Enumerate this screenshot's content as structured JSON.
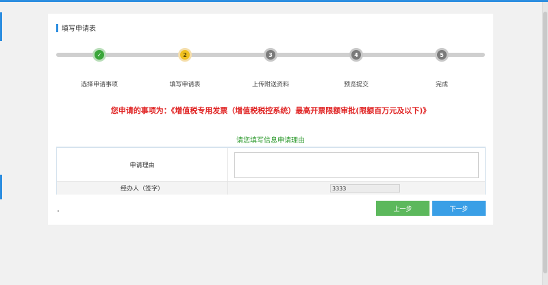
{
  "panel": {
    "title": "填写申请表"
  },
  "steps": [
    {
      "num": "✓",
      "label": "选择申请事项",
      "state": "done"
    },
    {
      "num": "2",
      "label": "填写申请表",
      "state": "current"
    },
    {
      "num": "3",
      "label": "上传附送资料",
      "state": "pending"
    },
    {
      "num": "4",
      "label": "预览提交",
      "state": "pending"
    },
    {
      "num": "5",
      "label": "完成",
      "state": "pending"
    }
  ],
  "notice": "您申请的事项为：《增值税专用发票（增值税税控系统）最高开票限额审批(限额百万元及以下)》",
  "form": {
    "heading": "请您填写信息申请理由",
    "reason_label": "申请理由",
    "reason_value": "",
    "agent_label": "经办人（签字）",
    "agent_value": "3333"
  },
  "buttons": {
    "prev": "上一步",
    "next": "下一步"
  },
  "colors": {
    "accent": "#2d8ee0",
    "done": "#3aa63a",
    "current": "#f0c020",
    "pending": "#7a7a7a",
    "notice": "#e02424",
    "heading": "#2e9a2e"
  }
}
